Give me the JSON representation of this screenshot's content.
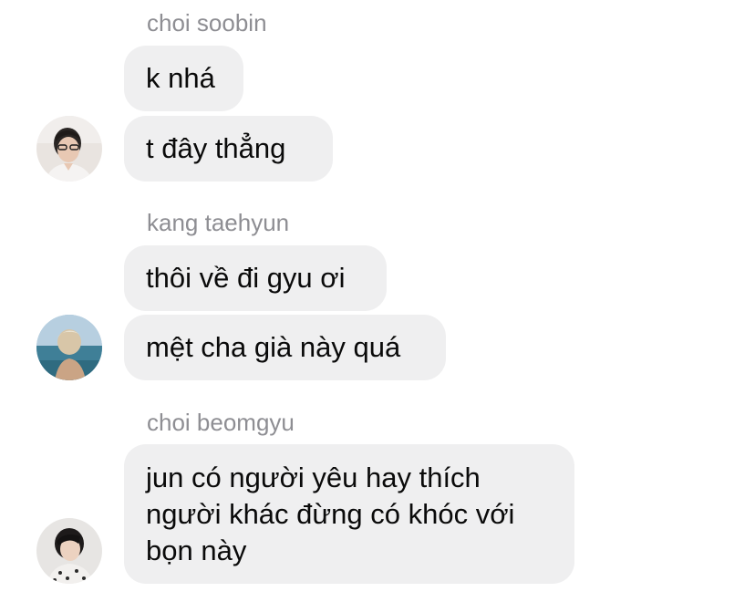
{
  "messages": [
    {
      "sender": "choi soobin",
      "avatar_icon": "profile-photo-icon",
      "bubbles": [
        "k nhá",
        "t đây thẳng"
      ]
    },
    {
      "sender": "kang taehyun",
      "avatar_icon": "profile-photo-icon",
      "bubbles": [
        "thôi về đi gyu ơi",
        "mệt cha già này quá"
      ]
    },
    {
      "sender": "choi beomgyu",
      "avatar_icon": "profile-photo-icon",
      "bubbles": [
        "jun có người yêu hay thích người khác đừng có khóc với bọn này"
      ]
    }
  ],
  "colors": {
    "bubble_bg": "#efeff0",
    "sender_text": "#8e8e93",
    "message_text": "#0a0a0a",
    "background": "#ffffff"
  }
}
